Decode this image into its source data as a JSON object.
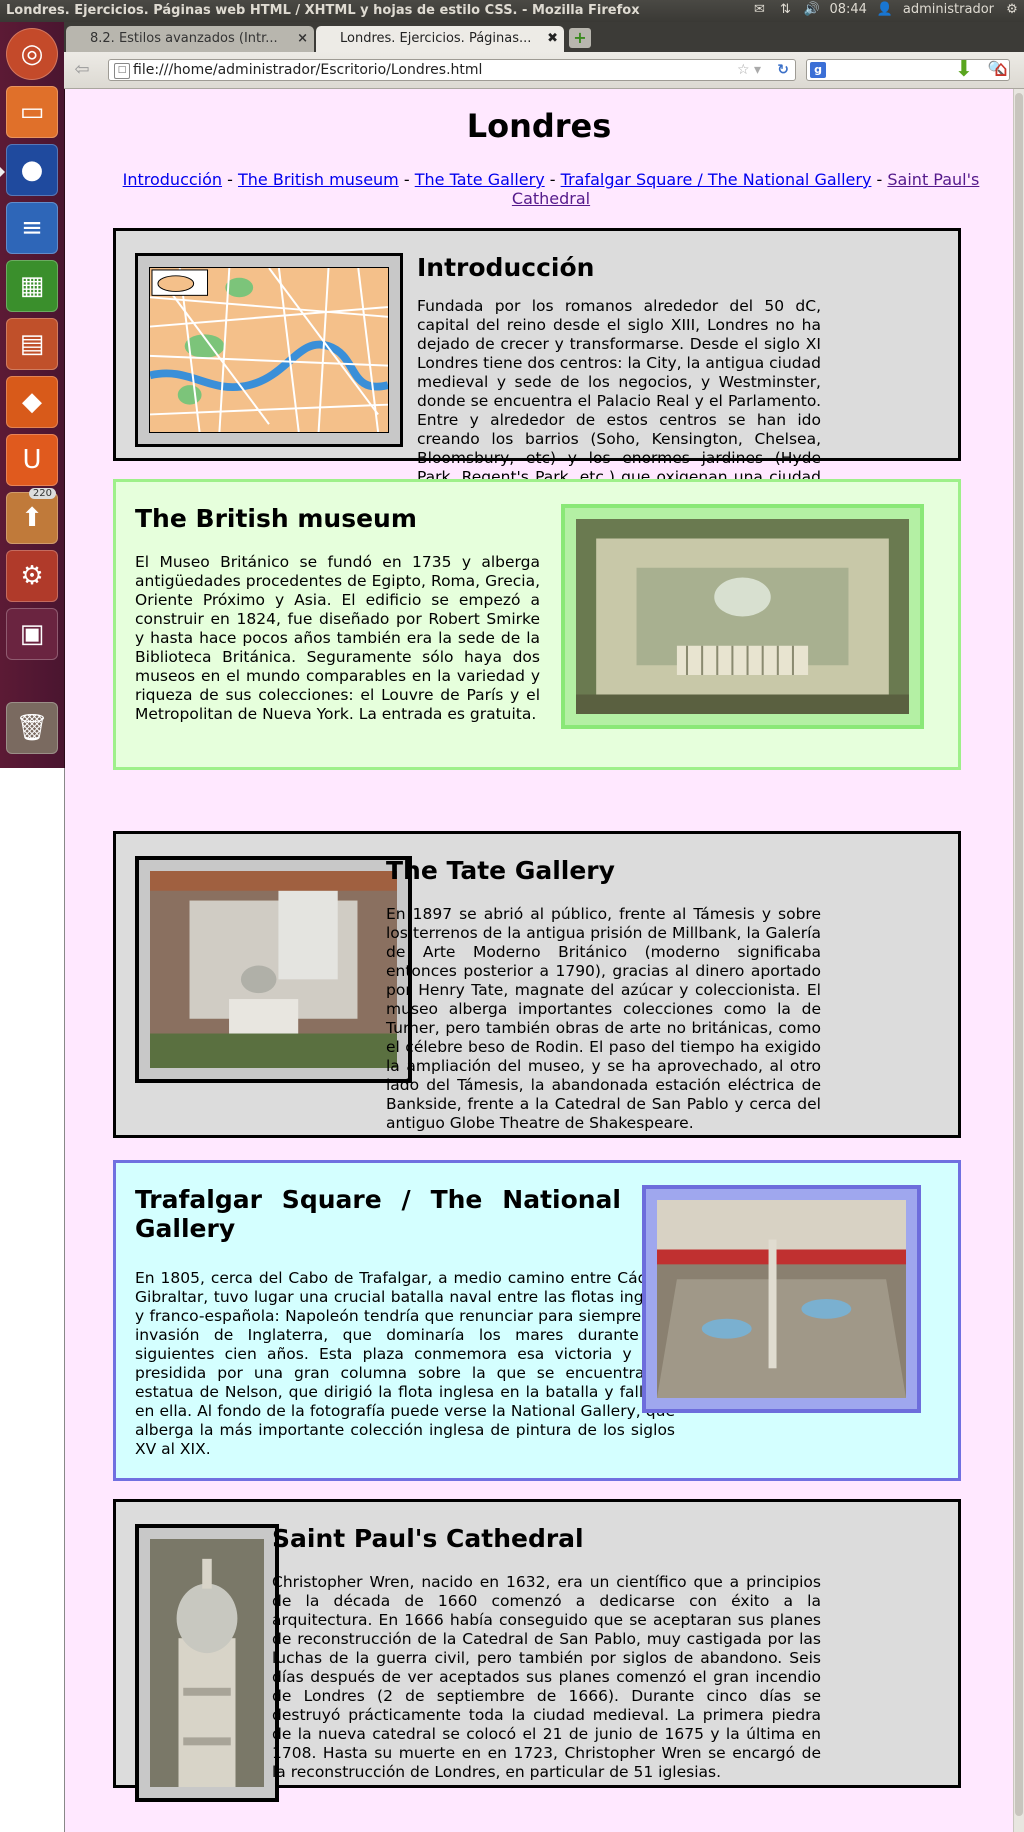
{
  "window": {
    "title": "Londres. Ejercicios. Páginas web HTML / XHTML y hojas de estilo CSS. - Mozilla Firefox",
    "clock": "08:44",
    "user": "administrador"
  },
  "launcher": {
    "badge": "220",
    "items": [
      "ubuntu-icon",
      "files-icon",
      "firefox-icon",
      "writer-icon",
      "calc-icon",
      "impress-icon",
      "software-center-icon",
      "ubuntu-one-icon",
      "update-manager-icon",
      "system-settings-icon",
      "workspace-switcher-icon",
      "trash-icon"
    ]
  },
  "tabs": [
    {
      "label": "8.2. Estilos avanzados (Intr..."
    },
    {
      "label": "Londres. Ejercicios. Páginas..."
    }
  ],
  "navbar": {
    "url": "file:///home/administrador/Escritorio/Londres.html",
    "search_placeholder": ""
  },
  "page": {
    "title": "Londres",
    "menu": [
      {
        "label": "Introducción"
      },
      {
        "label": "The British museum"
      },
      {
        "label": "The Tate Gallery"
      },
      {
        "label": "Trafalgar Square / The National Gallery"
      },
      {
        "label": "Saint Paul's Cathedral"
      }
    ],
    "separator": " - ",
    "sections": [
      {
        "title": "Introducción",
        "text": "Fundada por los romanos alrededor del 50 dC, capital del reino desde el siglo XIII, Londres no ha dejado de crecer y transformarse. Desde el siglo XI Londres tiene dos centros: la City, la antigua ciudad medieval y sede de los negocios, y Westminster, donde se encuentra el Palacio Real y el Parlamento. Entre y alrededor de estos centros se han ido creando los barrios (Soho, Kensington, Chelsea, Bloomsbury, etc) y los enormes jardines (Hyde Park, Regent's Park, etc.) que oxigenan una ciudad cosmopolita.",
        "bg": "#dcdcdc",
        "border": "#000000"
      },
      {
        "title": "The British museum",
        "text": "El Museo Británico se fundó en 1735 y alberga antigüedades procedentes de Egipto, Roma, Grecia, Oriente Próximo y Asia. El edificio se empezó a construir en 1824, fue diseñado por Robert Smirke y hasta hace pocos años también era la sede de la Biblioteca Británica. Seguramente sólo haya dos museos en el mundo comparables en la variedad y riqueza de sus colecciones: el Louvre de París y el Metropolitan de Nueva York. La entrada es gratuita.",
        "bg": "#e6ffdc",
        "border": "#9ef08a"
      },
      {
        "title": "The Tate Gallery",
        "text": "En 1897 se abrió al público, frente al Támesis y sobre los terrenos de la antigua prisión de Millbank, la Galería de Arte Moderno Británico (moderno significaba entonces posterior a 1790), gracias al dinero aportado por Henry Tate, magnate del azúcar y coleccionista. El museo alberga importantes colecciones como la de Turner, pero también obras de arte no británicas, como el célebre beso de Rodin. El paso del tiempo ha exigido la ampliación del museo, y se ha aprovechado, al otro lado del Támesis, la abandonada estación eléctrica de Bankside, frente a la Catedral de San Pablo y cerca del antiguo Globe Theatre de Shakespeare.",
        "bg": "#dcdcdc",
        "border": "#000000"
      },
      {
        "title": "Trafalgar Square / The National Gallery",
        "text": "En 1805, cerca del Cabo de Trafalgar, a medio camino entre Cádiz y Gibraltar, tuvo lugar una crucial batalla naval entre las flotas inglesa y franco-española: Napoleón tendría que renunciar para siempre a la invasión de Inglaterra, que dominaría los mares durante los siguientes cien años. Esta plaza conmemora esa victoria y está presidida por una gran columna sobre la que se encuentra un estatua de Nelson, que dirigió la flota inglesa en la batalla y falleció en ella. Al fondo de la fotografía puede verse la National Gallery, que alberga la más importante colección inglesa de pintura de los siglos XV al XIX.",
        "bg": "#d4ffff",
        "border": "#7070e0"
      },
      {
        "title": "Saint Paul's Cathedral",
        "text": "Christopher Wren, nacido en 1632, era un científico que a principios de la década de 1660 comenzó a dedicarse con éxito a la arquitectura. En 1666 había conseguido que se aceptaran sus planes de reconstrucción de la Catedral de San Pablo, muy castigada por las luchas de la guerra civil, pero también por siglos de abandono. Seis días después de ver aceptados sus planes comenzó el gran incendio de Londres (2 de septiembre de 1666). Durante cinco días se destruyó prácticamente toda la ciudad medieval. La primera piedra de la nueva catedral se colocó el 21 de junio de 1675 y la última en 1708. Hasta su muerte en en 1723, Christopher Wren se encargó de la reconstrucción de Londres, en particular de 51 iglesias.",
        "bg": "#dcdcdc",
        "border": "#000000"
      }
    ]
  }
}
